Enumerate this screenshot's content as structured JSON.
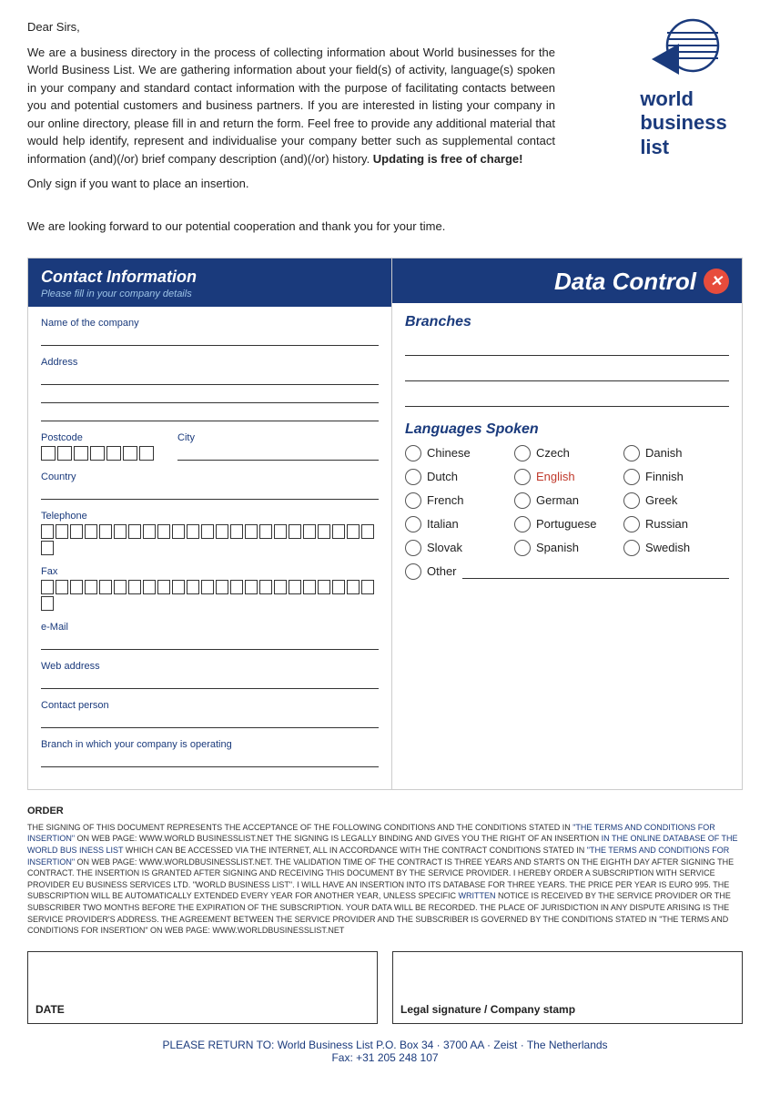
{
  "letter": {
    "greeting": "Dear Sirs,",
    "paragraph1": "We are a business directory in the process of collecting information about World businesses for the World Business List. We are gathering information about your field(s) of activity, language(s) spoken in your company and standard contact information with the purpose of facilitating contacts between you and potential customers and business partners. If you are interested in listing your company in our online directory, please fill in and return the form. Feel free to provide any additional material that would help identify, represent and individualise your company better such as supplemental contact information (and)(/or) brief company description (and)(/or) history.",
    "bold_part": "Updating is free of charge!",
    "note": "Only sign if you want to place an insertion.",
    "closing": "We are looking forward to our potential cooperation and thank you for your time."
  },
  "logo": {
    "text_line1": "world",
    "text_line2": "business",
    "text_line3": "list"
  },
  "contact_panel": {
    "title": "Contact Information",
    "subtitle": "Please fill in your company details",
    "fields": {
      "company_name": "Name of the company",
      "address": "Address",
      "postcode": "Postcode",
      "city": "City",
      "country": "Country",
      "telephone": "Telephone",
      "fax": "Fax",
      "email": "e-Mail",
      "web": "Web address",
      "contact_person": "Contact person",
      "branch": "Branch in which your company is operating"
    }
  },
  "data_panel": {
    "title": "Data Control",
    "x_icon": "✕",
    "branches_title": "Branches",
    "languages_title": "Languages Spoken",
    "languages": [
      "Chinese",
      "Czech",
      "Danish",
      "Dutch",
      "English",
      "Finnish",
      "French",
      "German",
      "Greek",
      "Italian",
      "Portuguese",
      "Russian",
      "Slovak",
      "Spanish",
      "Swedish"
    ],
    "other_label": "Other"
  },
  "order": {
    "title": "ORDER",
    "text": "THE SIGNING OF THIS DOCUMENT REPRESENTS THE ACCEPTANCE OF THE FOLLOWING CONDITIONS AND THE CONDITIONS STATED IN \"THE TERMS AND CONDITIONS FOR INSERTION\" ON WEB PAGE: WWW.WORLD BUSINESSLIST.NET THE SIGNING IS LEGALLY BINDING AND GIVES YOU THE RIGHT OF AN INSERTION IN THE ONLINE DATABASE OF THE WORLD BUS INESS LIST WHICH CAN BE ACCESSED VIA THE INTERNET, ALL IN ACCORDANCE WITH THE CONTRACT CONDITIONS STATED IN \"THE TERMS AND CONDITIONS FOR INSERTION\" ON WEB PAGE: WWW.WORLDBUSINESSLIST.NET. THE VALIDATION TIME OF THE CONTRACT IS THREE YEARS AND STARTS ON THE EIGHTH DAY AFTER SIGNING THE CONTRACT. THE INSERTION IS GRANTED AFTER SIGNING AND RECEIVING THIS DOCUMENT BY THE SERVICE PROVIDER. I HEREBY ORDER A SUBSCRIPTION WITH SERVICE PROVIDER EU BUSINESS SERVICES LTD. \"WORLD BUSINESS LIST\". I WILL HAVE AN INSERTION INTO ITS DATABASE FOR THREE YEARS. THE PRICE PER YEAR IS EURO 995. THE SUBSCRIPTION WILL BE AUTOMATICALLY EXTENDED EVERY YEAR FOR ANOTHER YEAR, UNLESS SPECIFIC WRITTEN NOTICE IS RECEIVED BY THE SERVICE PROVIDER OR THE SUBSCRIBER TWO MONTHS BEFORE THE EXPIRATION OF THE SUBSCRIPTION. YOUR DATA WILL BE RECORDED. THE PLACE OF JURISDICTION IN ANY DISPUTE ARISING IS THE SERVICE PROVIDER'S ADDRESS. THE AGREEMENT BETWEEN THE SERVICE PROVIDER AND THE SUBSCRIBER IS GOVERNED BY THE CONDITIONS STATED IN \"THE TERMS AND CONDITIONS FOR INSERTION\" ON WEB PAGE: WWW.WORLDBUSINESSLIST.NET"
  },
  "signature": {
    "date_label": "DATE",
    "legal_label": "Legal signature / Company stamp"
  },
  "footer": {
    "line1": "PLEASE RETURN TO: World Business List P.O. Box 34 · 3700 AA · Zeist · The Netherlands",
    "line2": "Fax: +31 205 248 107"
  }
}
